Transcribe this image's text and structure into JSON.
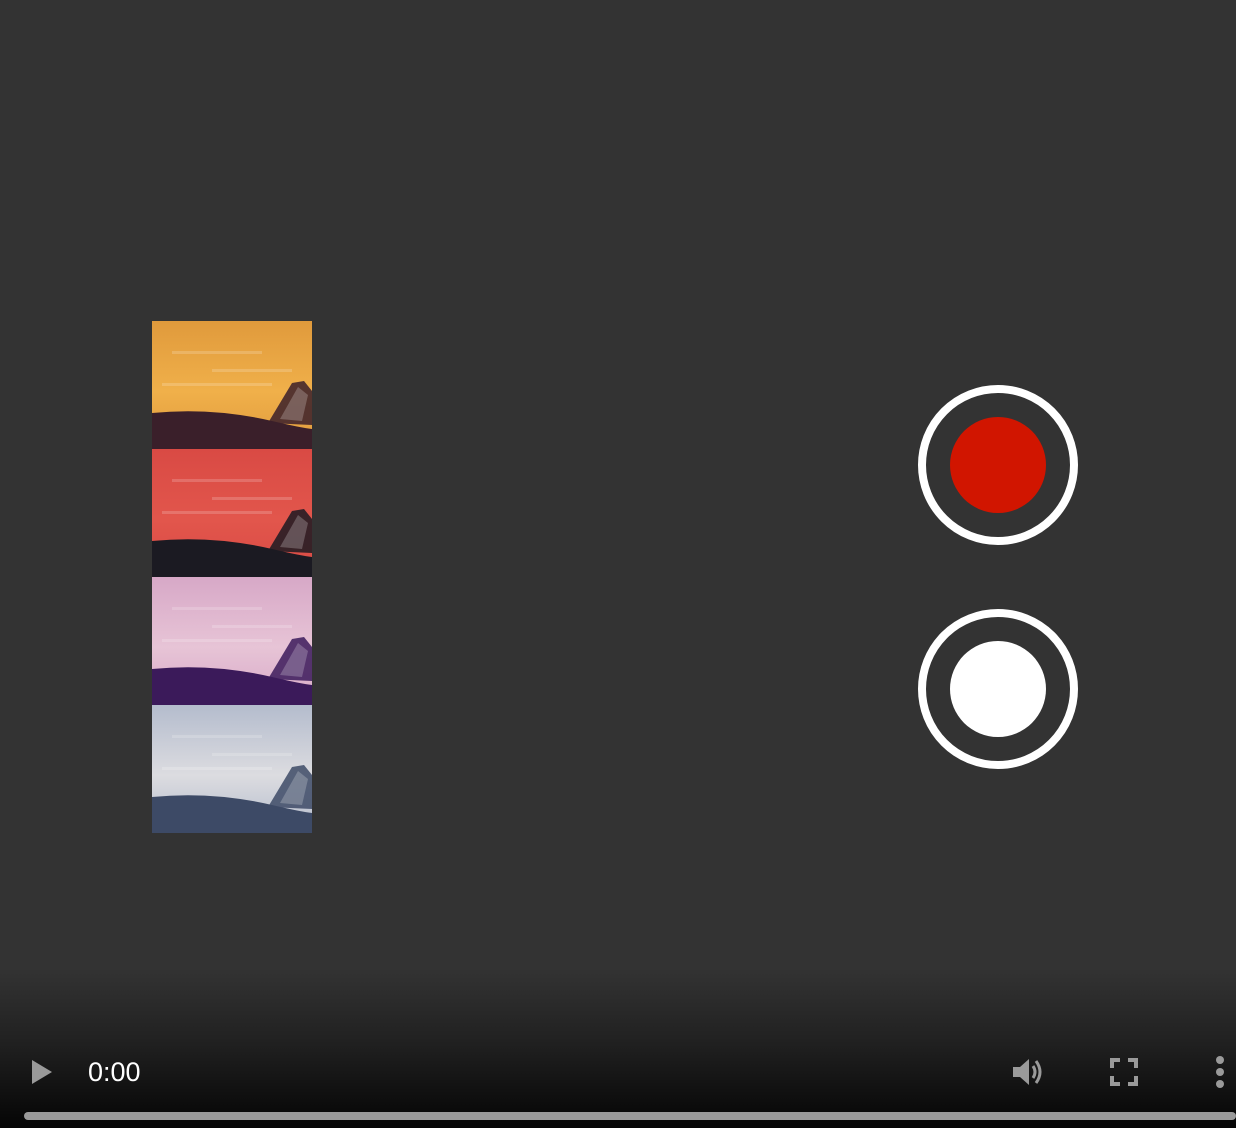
{
  "video_player": {
    "current_time": "0:00",
    "progress": 0
  },
  "filters": [
    {
      "name": "warm",
      "sky": "#e09a3c",
      "sky_light": "#f0b04a",
      "ground": "#3a1f2a"
    },
    {
      "name": "red",
      "sky": "#d94a44",
      "sky_light": "#e2564c",
      "ground": "#1b1a22"
    },
    {
      "name": "lavender",
      "sky": "#d7a8c7",
      "sky_light": "#e7c4d6",
      "ground": "#3b1a5a"
    },
    {
      "name": "cool",
      "sky": "#b4bccd",
      "sky_light": "#dcdce0",
      "ground": "#3d4a66"
    }
  ],
  "buttons": {
    "record": {
      "dot_color": "#d11500",
      "ring_color": "#ffffff"
    },
    "photo": {
      "dot_color": "#ffffff",
      "ring_color": "#ffffff"
    }
  },
  "colors": {
    "background": "#333333",
    "control_icon": "#9a9a9a",
    "timeline": "#9a9a9a"
  },
  "icons": [
    "play-icon",
    "volume-icon",
    "fullscreen-icon",
    "more-vert-icon"
  ]
}
